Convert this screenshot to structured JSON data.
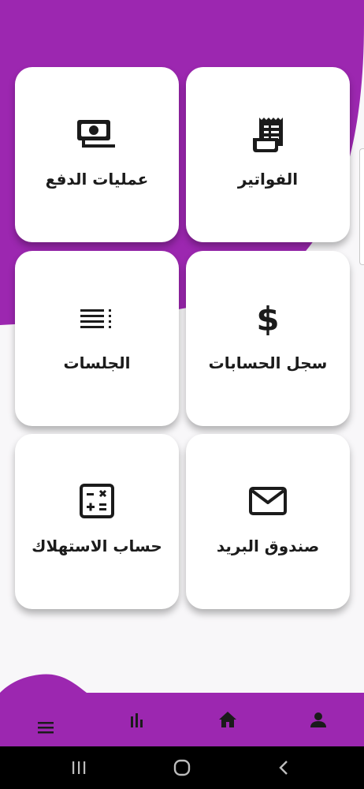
{
  "theme": {
    "accent": "#9c27b0",
    "card_background": "#ffffff",
    "page_background": "#f8f7f9",
    "text_color": "#1b1b1b",
    "system_bar": "#000000"
  },
  "menu": {
    "invoices": {
      "label": "الفواتير",
      "icon": "receipt-icon"
    },
    "payments": {
      "label": "عمليات الدفع",
      "icon": "money-icon"
    },
    "account_log": {
      "label": "سجل الحسابات",
      "icon": "dollar-icon"
    },
    "sessions": {
      "label": "الجلسات",
      "icon": "list-icon"
    },
    "mailbox": {
      "label": "صندوق البريد",
      "icon": "mail-icon"
    },
    "consumption_calc": {
      "label": "حساب الاستهلاك",
      "icon": "calculator-icon"
    }
  },
  "bottom_nav": {
    "items": [
      "profile-icon",
      "home-icon",
      "bar-chart-icon",
      "menu-icon"
    ]
  },
  "system_nav": {
    "items": [
      "recent-apps-icon",
      "home-circle-icon",
      "back-icon"
    ]
  }
}
